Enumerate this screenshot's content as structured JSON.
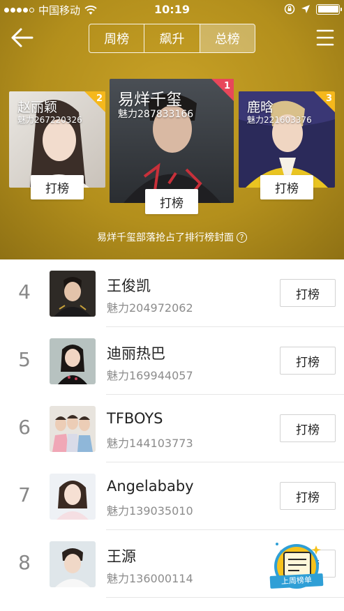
{
  "status_bar": {
    "carrier": "中国移动",
    "time": "10:19"
  },
  "tabs": [
    {
      "label": "周榜",
      "active": false
    },
    {
      "label": "飙升",
      "active": false
    },
    {
      "label": "总榜",
      "active": true
    }
  ],
  "podium": {
    "first": {
      "rank": "1",
      "name": "易烊千玺",
      "charm": "魅力287833166",
      "button": "打榜"
    },
    "second": {
      "rank": "2",
      "name": "赵丽颖",
      "charm": "魅力267220326",
      "button": "打榜"
    },
    "third": {
      "rank": "3",
      "name": "鹿晗",
      "charm": "魅力221603376",
      "button": "打榜"
    }
  },
  "cover_note": "易烊千玺部落抢占了排行榜封面",
  "list": [
    {
      "rank": "4",
      "name": "王俊凯",
      "charm": "魅力204972062",
      "button": "打榜"
    },
    {
      "rank": "5",
      "name": "迪丽热巴",
      "charm": "魅力169944057",
      "button": "打榜"
    },
    {
      "rank": "6",
      "name": "TFBOYS",
      "charm": "魅力144103773",
      "button": "打榜"
    },
    {
      "rank": "7",
      "name": "Angelababy",
      "charm": "魅力139035010",
      "button": "打榜"
    },
    {
      "rank": "8",
      "name": "王源",
      "charm": "魅力136000114",
      "button": "打榜"
    }
  ],
  "last_week_badge": "上周榜单",
  "colors": {
    "header_gold": "#b38f1c",
    "rank1_corner": "#e8475a",
    "rank23_corner": "#f5b81c",
    "badge_blue": "#2f9fd6"
  }
}
